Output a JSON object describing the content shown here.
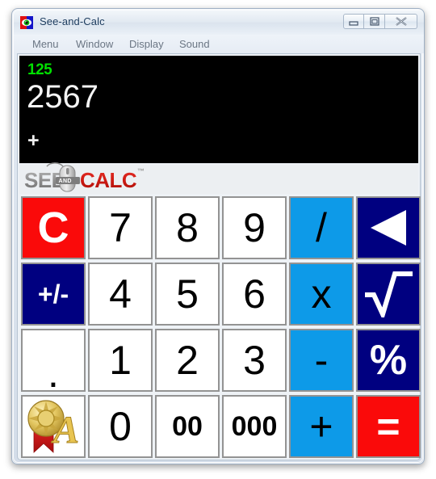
{
  "window": {
    "title": "See-and-Calc",
    "app_icon": "see-and-calc-icon",
    "controls": {
      "minimize": "minimize-icon",
      "maximize": "maximize-icon",
      "close": "close-icon"
    }
  },
  "menubar": {
    "items": [
      {
        "label": "Menu"
      },
      {
        "label": "Window"
      },
      {
        "label": "Display"
      },
      {
        "label": "Sound"
      }
    ]
  },
  "display": {
    "memory_value": "125",
    "main_value": "2567",
    "pending_operator": "+",
    "memory_color": "#00e000",
    "main_color": "#f4f4f4",
    "background": "#000000"
  },
  "logo": {
    "part1": "SEE",
    "part2": "AND",
    "part3": "CALC",
    "trademark": "™",
    "part1_color": "#9a9a9a",
    "part3_color": "#d42020"
  },
  "colors": {
    "light_blue": "#0d9ae8",
    "navy": "#000080",
    "red": "#fa0a0a",
    "white": "#ffffff",
    "key_border": "#939393"
  },
  "keypad": {
    "rows": [
      [
        {
          "name": "clear",
          "label": "C",
          "style": "red",
          "size": "clear"
        },
        {
          "name": "digit-7",
          "label": "7",
          "style": "white",
          "size": ""
        },
        {
          "name": "digit-8",
          "label": "8",
          "style": "white",
          "size": ""
        },
        {
          "name": "digit-9",
          "label": "9",
          "style": "white",
          "size": ""
        },
        {
          "name": "divide",
          "label": "/",
          "style": "lightblue",
          "size": ""
        },
        {
          "name": "backspace",
          "label": "",
          "style": "navy",
          "size": "",
          "icon": "backspace-triangle-icon"
        }
      ],
      [
        {
          "name": "sign-toggle",
          "label": "+/-",
          "style": "navy",
          "size": "pm"
        },
        {
          "name": "digit-4",
          "label": "4",
          "style": "white",
          "size": ""
        },
        {
          "name": "digit-5",
          "label": "5",
          "style": "white",
          "size": ""
        },
        {
          "name": "digit-6",
          "label": "6",
          "style": "white",
          "size": ""
        },
        {
          "name": "multiply",
          "label": "x",
          "style": "lightblue",
          "size": ""
        },
        {
          "name": "square-root",
          "label": "",
          "style": "navy",
          "size": "",
          "icon": "square-root-icon"
        }
      ],
      [
        {
          "name": "decimal-point",
          "label": ".",
          "style": "white",
          "size": "dot"
        },
        {
          "name": "digit-1",
          "label": "1",
          "style": "white",
          "size": ""
        },
        {
          "name": "digit-2",
          "label": "2",
          "style": "white",
          "size": ""
        },
        {
          "name": "digit-3",
          "label": "3",
          "style": "white",
          "size": ""
        },
        {
          "name": "subtract",
          "label": "-",
          "style": "lightblue",
          "size": ""
        },
        {
          "name": "percent",
          "label": "%",
          "style": "navy",
          "size": "pct"
        }
      ],
      [
        {
          "name": "award",
          "label": "",
          "style": "white",
          "size": "",
          "icon": "gold-medal-award-icon"
        },
        {
          "name": "digit-0",
          "label": "0",
          "style": "white",
          "size": ""
        },
        {
          "name": "double-zero",
          "label": "00",
          "style": "white",
          "size": "sm"
        },
        {
          "name": "triple-zero",
          "label": "000",
          "style": "white",
          "size": "sm"
        },
        {
          "name": "add",
          "label": "+",
          "style": "lightblue",
          "size": ""
        },
        {
          "name": "equals",
          "label": "=",
          "style": "red",
          "size": ""
        }
      ]
    ]
  }
}
